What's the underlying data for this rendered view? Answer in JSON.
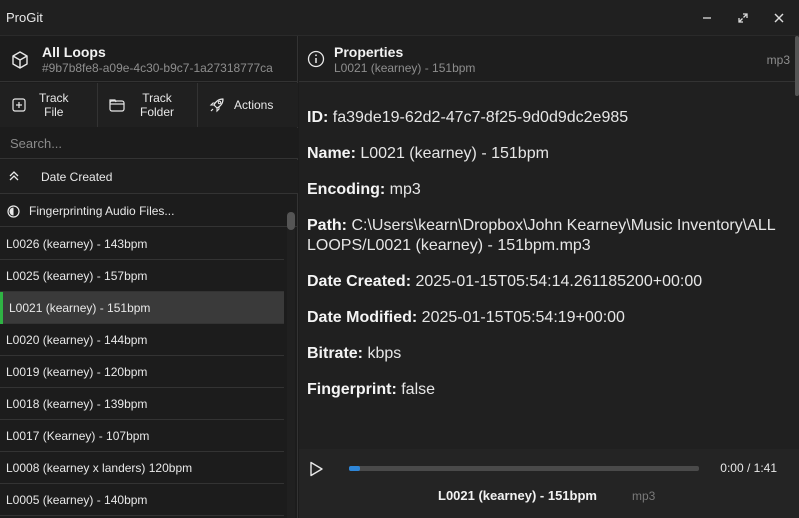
{
  "window": {
    "title": "ProGit",
    "controls": [
      "minimize-icon",
      "maximize-icon",
      "close-icon"
    ]
  },
  "library": {
    "title": "All Loops",
    "id": "#9b7b8fe8-a09e-4c30-b9c7-1a27318777ca",
    "icon": "cube-icon"
  },
  "toolbar": {
    "track_file": "Track\nFile",
    "track_folder": "Track\nFolder",
    "actions": "Actions"
  },
  "search": {
    "placeholder": "Search..."
  },
  "sort": {
    "label": "Date Created"
  },
  "status": {
    "label": "Fingerprinting Audio Files..."
  },
  "files": [
    "L0026 (kearney) - 143bpm",
    "L0025 (kearney) - 157bpm",
    "L0021 (kearney) - 151bpm",
    "L0020 (kearney) - 144bpm",
    "L0019 (kearney) - 120bpm",
    "L0018 (kearney) - 139bpm",
    "L0017 (Kearney) - 107bpm",
    "L0008 (kearney x landers) 120bpm",
    "L0005 (kearney) - 140bpm"
  ],
  "selected_index": 2,
  "properties": {
    "header_title": "Properties",
    "header_subtitle": "L0021 (kearney) - 151bpm",
    "header_ext": "mp3",
    "fields": [
      {
        "label": "ID:",
        "value": "fa39de19-62d2-47c7-8f25-9d0d9dc2e985"
      },
      {
        "label": "Name:",
        "value": "L0021 (kearney) - 151bpm"
      },
      {
        "label": "Encoding:",
        "value": "mp3"
      },
      {
        "label": "Path:",
        "value": "C:\\Users\\kearn\\Dropbox\\John Kearney\\Music Inventory\\ALL LOOPS/L0021 (kearney) - 151bpm.mp3"
      },
      {
        "label": "Date Created:",
        "value": "2025-01-15T05:54:14.261185200+00:00"
      },
      {
        "label": "Date Modified:",
        "value": "2025-01-15T05:54:19+00:00"
      },
      {
        "label": "Bitrate:",
        "value": "kbps"
      },
      {
        "label": "Fingerprint:",
        "value": "false"
      }
    ]
  },
  "player": {
    "time": "0:00 / 1:41",
    "progress": 0.03,
    "title": "L0021 (kearney) - 151bpm",
    "ext": "mp3"
  },
  "colors": {
    "selected_accent": "#2fb344",
    "progress_fill": "#2e86d8"
  }
}
